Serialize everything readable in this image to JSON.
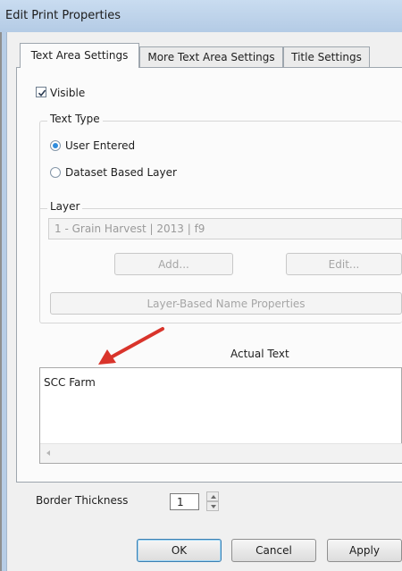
{
  "window": {
    "title": "Edit Print Properties"
  },
  "tabs": [
    {
      "label": "Text Area Settings",
      "active": true
    },
    {
      "label": "More Text Area Settings",
      "active": false
    },
    {
      "label": "Title Settings",
      "active": false
    }
  ],
  "visible": {
    "label": "Visible",
    "checked": true
  },
  "text_type": {
    "title": "Text Type",
    "options": [
      {
        "label": "User Entered",
        "selected": true
      },
      {
        "label": "Dataset Based Layer",
        "selected": false
      }
    ]
  },
  "layer": {
    "title": "Layer",
    "selected_value": "1 - Grain Harvest | 2013 | f9",
    "add_label": "Add...",
    "edit_label": "Edit...",
    "name_properties_label": "Layer-Based Name Properties"
  },
  "actual_text": {
    "label": "Actual Text",
    "value": "SCC Farm"
  },
  "border_thickness": {
    "label": "Border Thickness",
    "value": "1"
  },
  "footer": {
    "ok_label": "OK",
    "cancel_label": "Cancel",
    "apply_label": "Apply"
  },
  "colors": {
    "annotation_arrow": "#d9342b",
    "selected_radio": "#2f8cdc",
    "title_bar": "#b4cbe5"
  }
}
